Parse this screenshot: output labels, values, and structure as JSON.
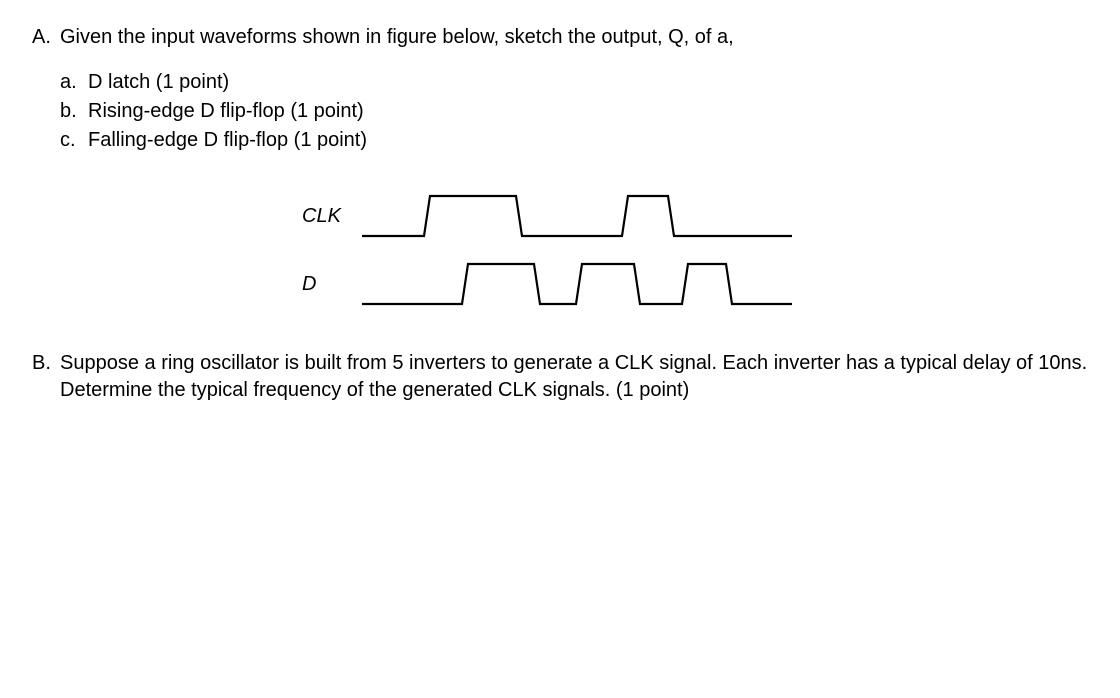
{
  "partA": {
    "letter": "A.",
    "intro": "Given the input waveforms shown in figure below, sketch the output, Q, of a,",
    "items": [
      {
        "letter": "a.",
        "text": "D latch (1 point)"
      },
      {
        "letter": "b.",
        "text": "Rising-edge D flip-flop (1 point)"
      },
      {
        "letter": "c.",
        "text": "Falling-edge D flip-flop (1 point)"
      }
    ]
  },
  "diagram": {
    "labels": {
      "clk": "CLK",
      "d": "D"
    }
  },
  "partB": {
    "letter": "B.",
    "text": "Suppose a ring oscillator is built from 5 inverters to generate a CLK signal. Each inverter has a typical delay of 10ns. Determine the typical frequency of the generated CLK signals. (1 point)"
  }
}
